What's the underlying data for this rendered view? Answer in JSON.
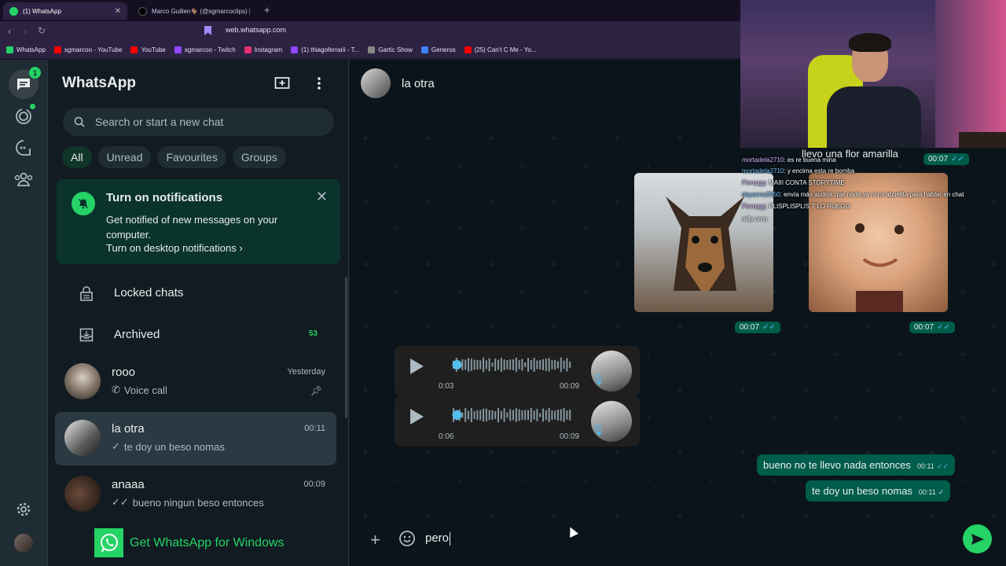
{
  "browser": {
    "tabs": [
      {
        "title": "(1) WhatsApp",
        "close": "✕"
      },
      {
        "title": "Marco Guillen🐐 (@sgmarcoclips) |"
      }
    ],
    "new_tab": "+",
    "url": "web.whatsapp.com",
    "bookmarks": [
      {
        "label": "WhatsApp",
        "color": "#25d366"
      },
      {
        "label": "sgmarcoo - YouTube",
        "color": "#ff0000"
      },
      {
        "label": "YouTube",
        "color": "#ff0000"
      },
      {
        "label": "sgmarcoo - Twitch",
        "color": "#9146ff"
      },
      {
        "label": "Instagram",
        "color": "#e1306c"
      },
      {
        "label": "(1) thiagoferrarii - T...",
        "color": "#9146ff"
      },
      {
        "label": "Gartic Show",
        "color": "#888888"
      },
      {
        "label": "Generos",
        "color": "#3b82f6"
      },
      {
        "label": "(25) Can't C Me - Yo...",
        "color": "#ff0000"
      }
    ]
  },
  "rail": {
    "chats_badge": "1"
  },
  "sidebar": {
    "title": "WhatsApp",
    "search_placeholder": "Search or start a new chat",
    "filters": [
      "All",
      "Unread",
      "Favourites",
      "Groups"
    ],
    "notification": {
      "title": "Turn on notifications",
      "body": "Get notified of new messages on your computer.",
      "link": "Turn on desktop notifications ›"
    },
    "locked": "Locked chats",
    "archived": "Archived",
    "archived_count": "53",
    "chats": [
      {
        "name": "rooo",
        "time": "Yesterday",
        "preview": "Voice call",
        "prefix": "✆"
      },
      {
        "name": "la otra",
        "time": "00:11",
        "preview": "te doy un beso nomas",
        "prefix": "✓"
      },
      {
        "name": "anaaa",
        "time": "00:09",
        "preview": "bueno ningun beso entonces",
        "prefix": "✓✓"
      }
    ],
    "get_windows": "Get WhatsApp for Windows"
  },
  "conversation": {
    "contact": "la otra",
    "image_times": [
      "00:07",
      "00:07",
      "00:07"
    ],
    "voice_notes": [
      {
        "position": "0:03",
        "duration": "00:09",
        "progress": 0.05
      },
      {
        "position": "0:06",
        "duration": "00:09",
        "progress": 0.05
      }
    ],
    "partial_text": "llevo una flor amarilla",
    "messages": [
      {
        "text": "bueno no te llevo nada entonces",
        "time": "00:11"
      },
      {
        "text": "te doy un beso nomas",
        "time": "00:11"
      }
    ],
    "compose_text": "pero"
  },
  "stream_chat": [
    {
      "user": "mortadela2710",
      "text": ": es re buena mina"
    },
    {
      "user": "mortadela2710",
      "text": ": y encima esta re bomba"
    },
    {
      "user": "Florrpgg",
      "text": ": MAIII CONTA STORYTIME"
    },
    {
      "user": "dayanna2850",
      "text": ": envía más audios que nada,ya ni mi abuelita para hablar en chat"
    },
    {
      "user": "Florrpgg",
      "text": ": PLISPLISPLIS T LO RUEGO"
    }
  ],
  "stream_chat_extra": "rally creo",
  "colors": {
    "accent": "#25d366",
    "bubble": "#005c4b",
    "panel": "#111b21",
    "read_tick": "#53bdeb"
  }
}
